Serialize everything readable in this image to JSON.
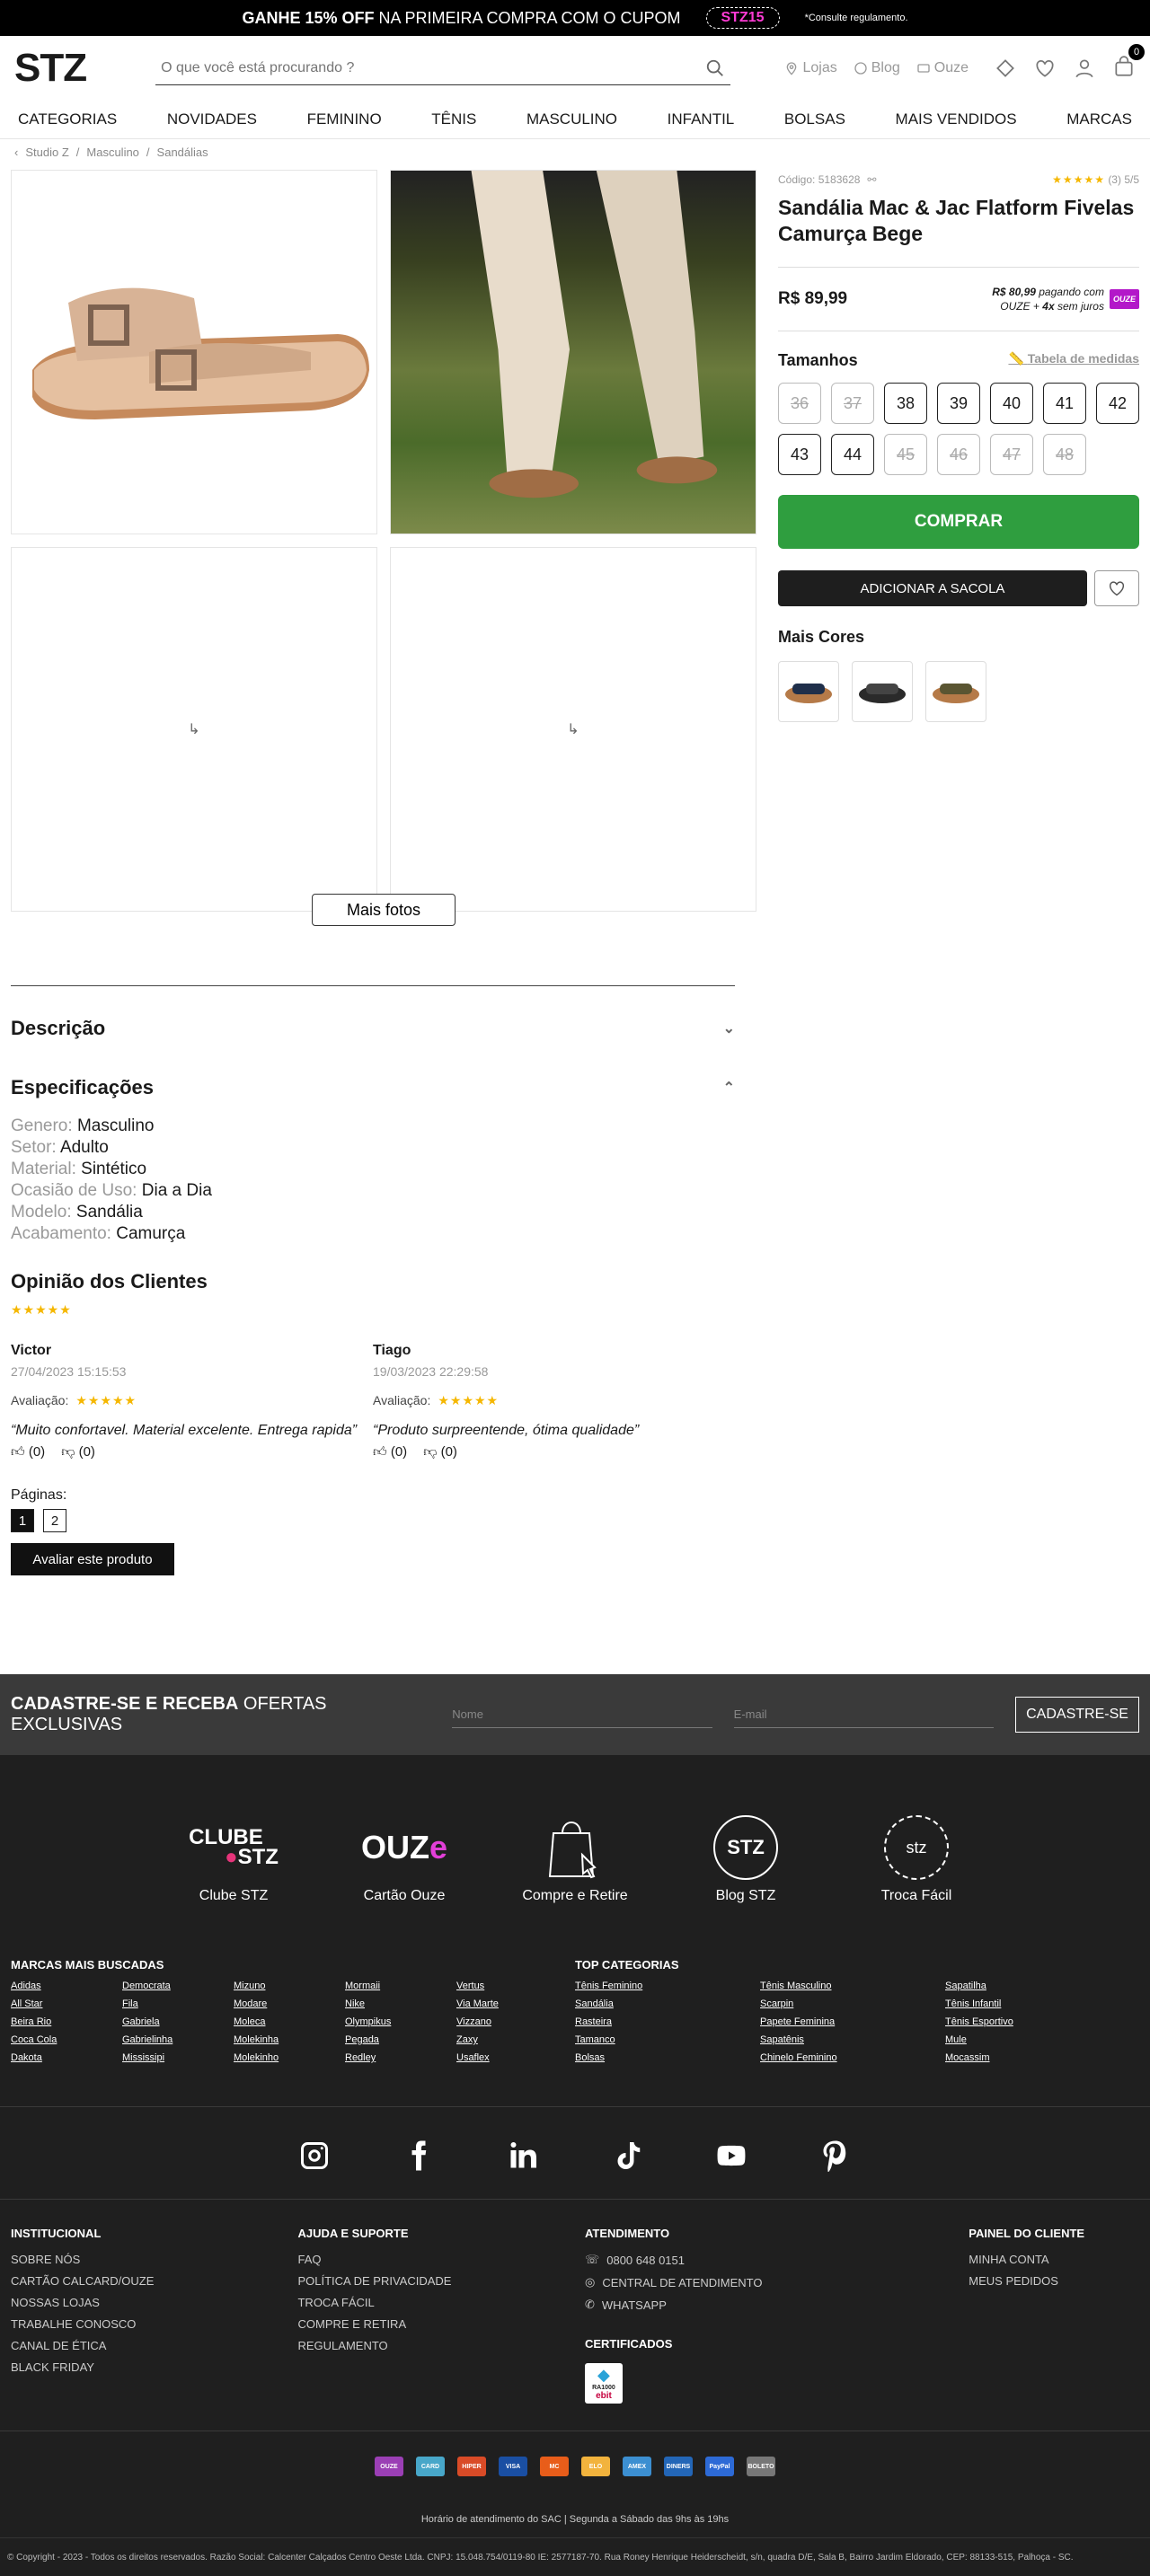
{
  "topbar": {
    "promo_bold": "GANHE 15% OFF",
    "promo_rest": "NA PRIMEIRA COMPRA COM O CUPOM",
    "coupon": "STZ15",
    "note": "*Consulte regulamento."
  },
  "header": {
    "logo": "STZ",
    "search_placeholder": "O que você está procurando ?",
    "links": [
      "Lojas",
      "Blog",
      "Ouze"
    ],
    "bag_count": "0"
  },
  "nav": [
    "CATEGORIAS",
    "NOVIDADES",
    "FEMININO",
    "TÊNIS",
    "MASCULINO",
    "INFANTIL",
    "BOLSAS",
    "MAIS VENDIDOS",
    "MARCAS"
  ],
  "breadcrumb": [
    "Studio Z",
    "Masculino",
    "Sandálias"
  ],
  "gallery": {
    "more_button": "Mais fotos"
  },
  "product": {
    "code": "Código: 5183628",
    "rating_text": "(3) 5/5",
    "title": "Sandália Mac & Jac Flatform Fivelas Camurça Bege",
    "price": "R$ 89,99",
    "ouze_price": "R$ 80,99",
    "ouze_text": " pagando com",
    "ouze_inst_a": "OUZE + ",
    "ouze_inst_b": "4x",
    "ouze_inst_c": " sem juros",
    "ouze_badge": "OUZE",
    "sizes_title": "Tamanhos",
    "size_table": "Tabela de medidas",
    "sizes": [
      {
        "n": "36",
        "ok": false
      },
      {
        "n": "37",
        "ok": false
      },
      {
        "n": "38",
        "ok": true
      },
      {
        "n": "39",
        "ok": true
      },
      {
        "n": "40",
        "ok": true
      },
      {
        "n": "41",
        "ok": true
      },
      {
        "n": "42",
        "ok": true
      },
      {
        "n": "43",
        "ok": true
      },
      {
        "n": "44",
        "ok": true
      },
      {
        "n": "45",
        "ok": false
      },
      {
        "n": "46",
        "ok": false
      },
      {
        "n": "47",
        "ok": false
      },
      {
        "n": "48",
        "ok": false
      }
    ],
    "buy": "COMPRAR",
    "add_to_bag": "ADICIONAR A SACOLA",
    "more_colors": "Mais Cores"
  },
  "description": {
    "title": "Descrição"
  },
  "specs": {
    "title": "Especificações",
    "items": [
      {
        "k": "Genero:",
        "v": "Masculino"
      },
      {
        "k": "Setor:",
        "v": "Adulto"
      },
      {
        "k": "Material:",
        "v": "Sintético"
      },
      {
        "k": "Ocasião de Uso:",
        "v": "Dia a Dia"
      },
      {
        "k": "Modelo:",
        "v": "Sandália"
      },
      {
        "k": "Acabamento:",
        "v": "Camurça"
      }
    ]
  },
  "reviews": {
    "title": "Opinião dos Clientes",
    "eval_label": "Avaliação:",
    "items": [
      {
        "name": "Victor",
        "date": "27/04/2023 15:15:53",
        "text": "“Muito confortavel. Material excelente. Entrega rapida”",
        "up": "(0)",
        "down": "(0)"
      },
      {
        "name": "Tiago",
        "date": "19/03/2023 22:29:58",
        "text": "“Produto surpreentende, ótima qualidade”",
        "up": "(0)",
        "down": "(0)"
      }
    ],
    "pages_label": "Páginas:",
    "pages": [
      "1",
      "2"
    ],
    "rate_button": "Avaliar este produto"
  },
  "newsletter": {
    "title_bold": "CADASTRE-SE E RECEBA",
    "title_rest": " OFERTAS EXCLUSIVAS",
    "name_ph": "Nome",
    "email_ph": "E-mail",
    "button": "CADASTRE-SE"
  },
  "features": [
    {
      "label": "Clube STZ",
      "logo_a": "CLUBE",
      "logo_b": "STZ"
    },
    {
      "label": "Cartão Ouze",
      "logo_a": "OUZ",
      "logo_b": "e"
    },
    {
      "label": "Compre e Retire"
    },
    {
      "label": "Blog STZ",
      "logo_a": "STZ"
    },
    {
      "label": "Troca Fácil",
      "logo_a": "stz"
    }
  ],
  "brands": {
    "title": "MARCAS MAIS BUSCADAS",
    "items": [
      "Adidas",
      "All Star",
      "Beira Rio",
      "Coca Cola",
      "Dakota",
      "Democrata",
      "Fila",
      "Gabriela",
      "Gabrielinha",
      "Mississipi",
      "Mizuno",
      "Modare",
      "Moleca",
      "Molekinha",
      "Molekinho",
      "Mormaii",
      "Nike",
      "Olympikus",
      "Pegada",
      "Redley",
      "Vertus",
      "Via Marte",
      "Vizzano",
      "Zaxy",
      "Usaflex"
    ]
  },
  "topcats": {
    "title": "TOP CATEGORIAS",
    "items": [
      "Tênis Feminino",
      "Sandália",
      "Rasteira",
      "Tamanco",
      "Bolsas",
      "Tênis Masculino",
      "Scarpin",
      "Papete Feminina",
      "Sapatênis",
      "Chinelo Feminino",
      "Sapatilha",
      "Tênis Infantil",
      "Tênis Esportivo",
      "Mule",
      "Mocassim"
    ]
  },
  "footer": {
    "institucional": {
      "title": "INSTITUCIONAL",
      "items": [
        "SOBRE NÓS",
        "CARTÃO CALCARD/OUZE",
        "NOSSAS LOJAS",
        "TRABALHE CONOSCO",
        "CANAL DE ÉTICA",
        "BLACK FRIDAY"
      ]
    },
    "ajuda": {
      "title": "AJUDA E SUPORTE",
      "items": [
        "FAQ",
        "POLÍTICA DE PRIVACIDADE",
        "TROCA FÁCIL",
        "COMPRE E RETIRA",
        "REGULAMENTO"
      ]
    },
    "atendimento": {
      "title": "ATENDIMENTO",
      "items": [
        "0800 648 0151",
        "CENTRAL DE ATENDIMENTO",
        "WHATSAPP"
      ],
      "cert_title": "CERTIFICADOS",
      "cert_a": "RA1000",
      "cert_b": "ebit"
    },
    "painel": {
      "title": "PAINEL DO CLIENTE",
      "items": [
        "MINHA CONTA",
        "MEUS PEDIDOS"
      ]
    },
    "payments": [
      {
        "t": "OUZE",
        "c": "#9b3fb5"
      },
      {
        "t": "CARD",
        "c": "#48a7c9"
      },
      {
        "t": "HIPER",
        "c": "#d94b27"
      },
      {
        "t": "VISA",
        "c": "#1a4fa3"
      },
      {
        "t": "MC",
        "c": "#e85d1a"
      },
      {
        "t": "ELO",
        "c": "#f2b33d"
      },
      {
        "t": "AMEX",
        "c": "#3c8fd1"
      },
      {
        "t": "DINERS",
        "c": "#2366b7"
      },
      {
        "t": "PayPal",
        "c": "#2d6ad6"
      },
      {
        "t": "BOLETO",
        "c": "#777"
      }
    ],
    "hours": "Horário de atendimento do SAC | Segunda a Sábado das 9hs às 19hs",
    "copyright": "© Copyright - 2023 - Todos os direitos reservados. Razão Social: Calcenter Calçados Centro Oeste Ltda. CNPJ: 15.048.754/0119-80 IE: 2577187-70. Rua Roney Henrique Heiderscheidt, s/n, quadra D/E, Sala B, Bairro Jardim Eldorado, CEP: 88133-515, Palhoça - SC."
  }
}
